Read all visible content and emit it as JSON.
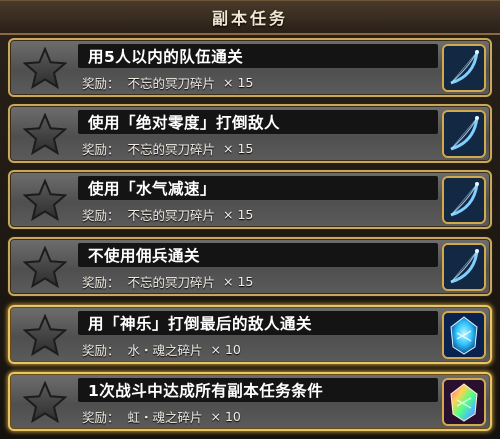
{
  "header": {
    "title": "副本任务"
  },
  "reward_label": "奖励：",
  "tasks": [
    {
      "title": "用5人以内的队伍通关",
      "reward_item": "不忘的冥刀碎片",
      "reward_qty": "× 15",
      "reward_icon": "bow-shard-icon",
      "completed": false
    },
    {
      "title": "使用「绝对零度」打倒敌人",
      "reward_item": "不忘的冥刀碎片",
      "reward_qty": "× 15",
      "reward_icon": "bow-shard-icon",
      "completed": false
    },
    {
      "title": "使用「水气减速」",
      "reward_item": "不忘的冥刀碎片",
      "reward_qty": "× 15",
      "reward_icon": "bow-shard-icon",
      "completed": false
    },
    {
      "title": "不使用佣兵通关",
      "reward_item": "不忘的冥刀碎片",
      "reward_qty": "× 15",
      "reward_icon": "bow-shard-icon",
      "completed": false
    },
    {
      "title": "用「神乐」打倒最后的敌人通关",
      "reward_item": "水・魂之碎片",
      "reward_qty": "× 10",
      "reward_icon": "water-soul-shard-icon",
      "completed": true
    },
    {
      "title": "1次战斗中达成所有副本任务条件",
      "reward_item": "虹・魂之碎片",
      "reward_qty": "× 10",
      "reward_icon": "rainbow-soul-shard-icon",
      "completed": true
    }
  ],
  "colors": {
    "frame_gold": "#c8a85c",
    "panel_grey": "#5b5b5b",
    "title_bar": "#141414",
    "water_shard": "#2ec4ff",
    "rainbow_shard": "#ff4fd0"
  }
}
